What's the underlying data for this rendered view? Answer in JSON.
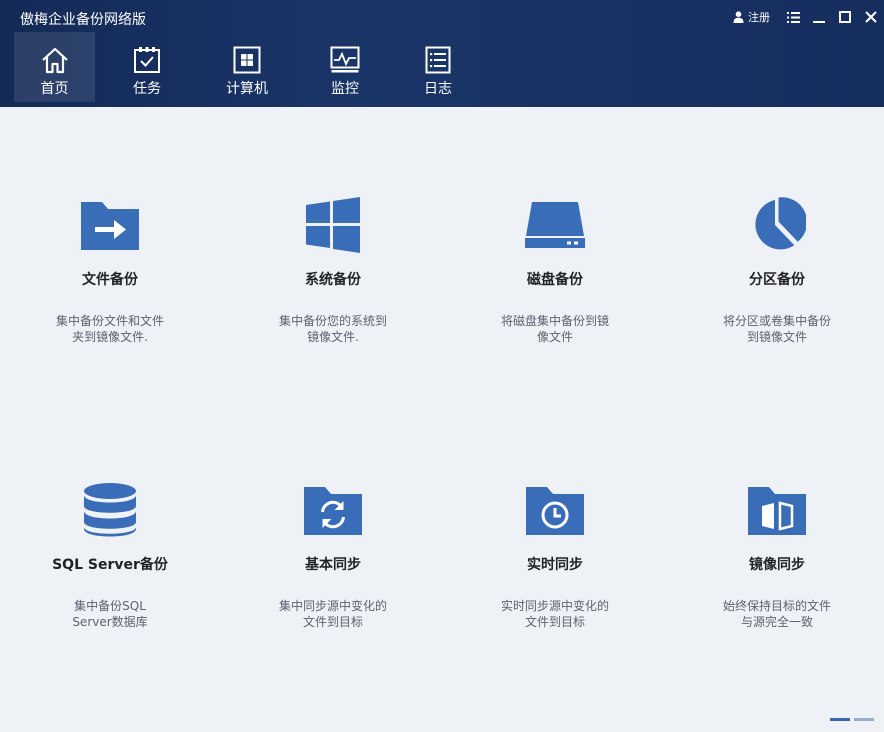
{
  "window": {
    "title": "傲梅企业备份网络版",
    "register_label": "注册"
  },
  "nav": {
    "items": [
      {
        "label": "首页",
        "icon": "home-icon",
        "active": true
      },
      {
        "label": "任务",
        "icon": "task-icon"
      },
      {
        "label": "计算机",
        "icon": "computer-icon"
      },
      {
        "label": "监控",
        "icon": "monitor-icon"
      },
      {
        "label": "日志",
        "icon": "log-icon"
      }
    ]
  },
  "cards": [
    {
      "title": "文件备份",
      "desc": "集中备份文件和文件夹到镜像文件.",
      "icon": "folder-arrow-icon"
    },
    {
      "title": "系统备份",
      "desc": "集中备份您的系统到镜像文件.",
      "icon": "windows-icon"
    },
    {
      "title": "磁盘备份",
      "desc": "将磁盘集中备份到镜像文件",
      "icon": "disk-icon"
    },
    {
      "title": "分区备份",
      "desc": "将分区或卷集中备份到镜像文件",
      "icon": "pie-icon"
    },
    {
      "title": "SQL Server备份",
      "desc": "集中备份SQL Server数据库",
      "icon": "database-icon"
    },
    {
      "title": "基本同步",
      "desc": "集中同步源中变化的文件到目标",
      "icon": "folder-sync-icon"
    },
    {
      "title": "实时同步",
      "desc": "实时同步源中变化的文件到目标",
      "icon": "folder-clock-icon"
    },
    {
      "title": "镜像同步",
      "desc": "始终保持目标的文件与源完全一致",
      "icon": "folder-mirror-icon"
    }
  ],
  "colors": {
    "header_bg": "#142a57",
    "accent": "#3a6db7",
    "content_bg": "#eef1f6"
  },
  "pager": {
    "pages": 2,
    "current": 1
  }
}
